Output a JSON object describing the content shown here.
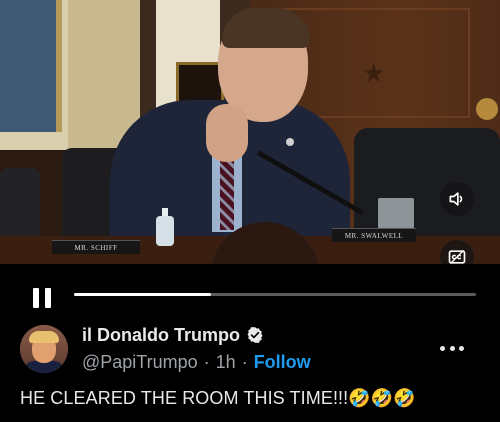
{
  "video": {
    "nameplate_left": "MR. SCHIFF",
    "nameplate_right": "MR. SWALWELL",
    "buttons": {
      "volume_icon": "speaker-volume-icon",
      "captions_icon": "closed-captions-icon"
    }
  },
  "player": {
    "state_icon": "pause-icon",
    "progress_fraction": 0.34
  },
  "post": {
    "author": {
      "display_name": "il Donaldo Trumpo",
      "handle": "@PapiTrumpo",
      "time": "1h",
      "separator": "·",
      "follow_label": "Follow",
      "verified": true
    },
    "text": "HE CLEARED THE ROOM THIS TIME!!!🤣🤣🤣"
  },
  "colors": {
    "background": "#000000",
    "accent": "#1d9bf0",
    "secondary_text": "#9ea3a8",
    "primary_text": "#e7e9ea"
  }
}
